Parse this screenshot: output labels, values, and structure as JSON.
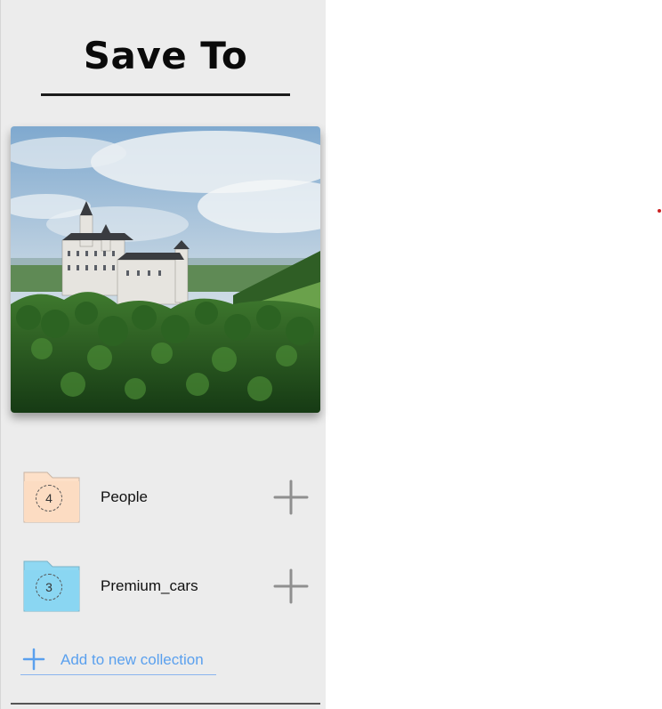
{
  "panel": {
    "title": "Save To",
    "image_alt": "castle-landscape"
  },
  "collections": [
    {
      "name": "People",
      "count": "4",
      "folder_color": "#fde0c8",
      "folder_tab_color": "#fce8d8"
    },
    {
      "name": "Premium_cars",
      "count": "3",
      "folder_color": "#8fd8f2",
      "folder_tab_color": "#a8e2f6"
    }
  ],
  "new_collection": {
    "label": "Add to new collection"
  },
  "colors": {
    "panel_bg": "#ececec",
    "accent_blue": "#5aa0ee",
    "marker_red": "#cc2222"
  }
}
